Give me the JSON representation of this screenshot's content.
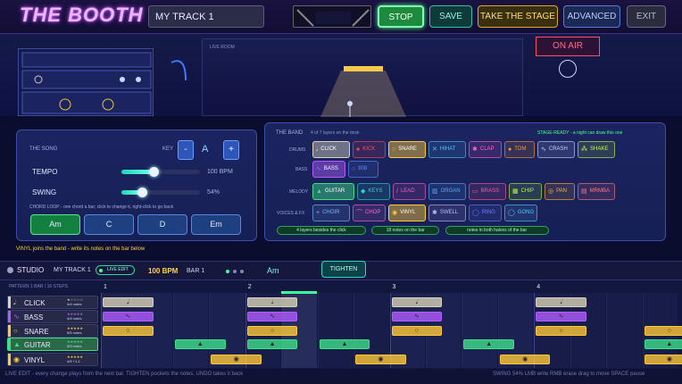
{
  "app": {
    "title": "THE BOOTH",
    "track_name": "MY TRACK 1"
  },
  "toolbar": {
    "stop": "STOP",
    "save": "SAVE",
    "take_stage": "TAKE THE STAGE",
    "advanced": "ADVANCED",
    "exit": "EXIT"
  },
  "stage": {
    "label": "LIVE ROOM",
    "on_air": "ON AIR"
  },
  "song": {
    "title": "THE SONG",
    "key_label": "KEY",
    "key_value": "A",
    "key_minus": "-",
    "key_plus": "+",
    "tempo_label": "TEMPO",
    "tempo_value": "100 BPM",
    "tempo_level": 0.41,
    "swing_label": "SWING",
    "swing_value": "54%",
    "swing_level": 0.26,
    "chord_hint": "CHORD LOOP - one chord a bar; click to change it, right-click to go back",
    "chords": [
      "Am",
      "C",
      "D",
      "Em"
    ]
  },
  "band": {
    "title": "THE BAND",
    "layers_text": "4 of 7 layers on the desk",
    "stage_ready": "STAGE-READY - a night can draw this one",
    "rows": [
      {
        "label": "DRUMS",
        "items": [
          {
            "name": "CLICK",
            "icon": "𝅘𝅥",
            "on": true,
            "c": "#d8d2b8"
          },
          {
            "name": "KICK",
            "icon": "●",
            "on": false,
            "c": "#ff4d5c"
          },
          {
            "name": "SNARE",
            "icon": "○",
            "on": true,
            "c": "#ffc93a"
          },
          {
            "name": "HIHAT",
            "icon": "✕",
            "on": false,
            "c": "#4dc3ff"
          },
          {
            "name": "CLAP",
            "icon": "✱",
            "on": false,
            "c": "#ff62d0"
          },
          {
            "name": "TOM",
            "icon": "●",
            "on": false,
            "c": "#ff9a2e"
          },
          {
            "name": "CRASH",
            "icon": "∿",
            "on": false,
            "c": "#cdd2ff"
          },
          {
            "name": "SHAKE",
            "icon": "⁂",
            "on": false,
            "c": "#c6ff4d"
          }
        ]
      },
      {
        "label": "BASS",
        "items": [
          {
            "name": "BASS",
            "icon": "∿",
            "on": true,
            "c": "#b05cff"
          },
          {
            "name": "808",
            "icon": "○",
            "on": false,
            "c": "#5b8cff"
          }
        ]
      },
      {
        "label": "MELODY",
        "items": [
          {
            "name": "GUITAR",
            "icon": "▲",
            "on": true,
            "c": "#3ee08a"
          },
          {
            "name": "KEYS",
            "icon": "◆",
            "on": false,
            "c": "#2fd6c8"
          },
          {
            "name": "LEAD",
            "icon": "/",
            "on": false,
            "c": "#ff5cc8"
          },
          {
            "name": "ORGAN",
            "icon": "▥",
            "on": false,
            "c": "#5baaff"
          },
          {
            "name": "BRASS",
            "icon": "▭",
            "on": false,
            "c": "#ff5c9c"
          },
          {
            "name": "CHIP",
            "icon": "▦",
            "on": false,
            "c": "#b8ff3a"
          },
          {
            "name": "PAN",
            "icon": "◎",
            "on": false,
            "c": "#ffb03a"
          },
          {
            "name": "MRMBA",
            "icon": "▤",
            "on": false,
            "c": "#ff7a8a"
          }
        ]
      },
      {
        "label": "VOICES & FX",
        "items": [
          {
            "name": "CHOIR",
            "icon": "+",
            "on": false,
            "c": "#7ab8ff"
          },
          {
            "name": "CHOP",
            "icon": "⌒",
            "on": false,
            "c": "#ff6bd6"
          },
          {
            "name": "VINYL",
            "icon": "◉",
            "on": true,
            "c": "#ffc93a"
          },
          {
            "name": "SWELL",
            "icon": "✱",
            "on": false,
            "c": "#c9b8ff"
          },
          {
            "name": "RING",
            "icon": "◯",
            "on": false,
            "c": "#6b7cff"
          },
          {
            "name": "GONG",
            "icon": "◯",
            "on": false,
            "c": "#5ac8ff"
          }
        ]
      }
    ],
    "goals": [
      "4 layers besides the click",
      "18 notes on the bar",
      "notes in both halves of the bar"
    ]
  },
  "message": "VINYL joins the band - write its notes on the bar below",
  "studio": {
    "title": "STUDIO",
    "track": "MY TRACK 1",
    "live_edit": "LIVE EDIT",
    "bpm": "100 BPM",
    "bar": "BAR 1",
    "chord": "Am",
    "tighten": "TIGHTEN"
  },
  "sequencer": {
    "pattern_label": "PATTERN 1 BAR / 16 STEPS",
    "beats": [
      "1",
      "2",
      "3",
      "4"
    ],
    "tracks": [
      {
        "name": "CLICK",
        "stars": "★☆☆☆☆",
        "notes": "4/4 notes",
        "color": "#d8d2b8",
        "icon": "𝅘𝅥",
        "steps": [
          0,
          4,
          8,
          12
        ]
      },
      {
        "name": "BASS",
        "stars": "★★★★★",
        "notes": "4/4 notes",
        "color": "#b05cff",
        "icon": "∿",
        "steps": [
          0,
          4,
          8,
          12
        ]
      },
      {
        "name": "SNARE",
        "stars": "★★★★★",
        "notes": "5/5 notes",
        "color": "#ffc93a",
        "icon": "○",
        "steps": [
          0,
          4,
          8,
          12,
          15
        ]
      },
      {
        "name": "GUITAR",
        "stars": "★★★★★",
        "notes": "5/5 notes",
        "color": "#3ee08a",
        "icon": "▲",
        "steps": [
          2,
          4,
          6,
          10,
          15
        ]
      },
      {
        "name": "VINYL",
        "stars": "★★★★★",
        "notes": "4/5 +1.2",
        "color": "#ffc93a",
        "icon": "◉",
        "steps": [
          3,
          7,
          11,
          15
        ]
      }
    ]
  },
  "footer": {
    "left": "LIVE EDIT - every change plays from the next bar. TIGHTEN pockets the notes, UNDO takes it back",
    "right": "SWING 54%  LMB write  RMB erase  drag to move  SPACE pause"
  }
}
